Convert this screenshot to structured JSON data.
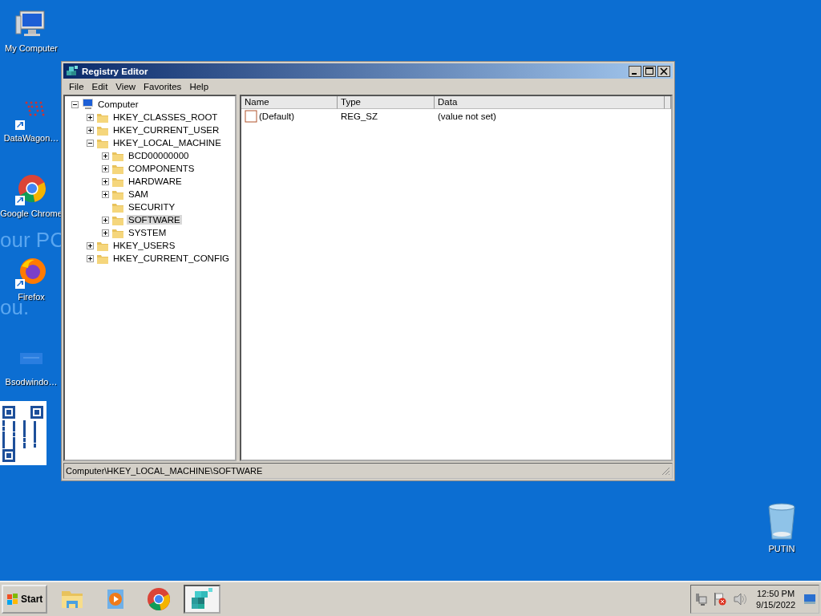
{
  "desktop": {
    "wallpaper_text": [
      "our PC",
      "ou."
    ],
    "icons": [
      {
        "label": "My Computer",
        "kind": "computer"
      },
      {
        "label": "DataWagon…",
        "kind": "datawagon"
      },
      {
        "label": "Google Chrome",
        "kind": "chrome"
      },
      {
        "label": "Firefox",
        "kind": "firefox"
      },
      {
        "label": "Bsodwindo…",
        "kind": "blank"
      },
      {
        "kind": "qr"
      }
    ],
    "recycle_bin": {
      "label": "PUTIN"
    }
  },
  "window": {
    "title": "Registry Editor",
    "menu": [
      "File",
      "Edit",
      "View",
      "Favorites",
      "Help"
    ],
    "tree": {
      "label": "Computer",
      "expanded": true,
      "selected": false,
      "children": [
        {
          "label": "HKEY_CLASSES_ROOT",
          "expanded": false,
          "selected": false,
          "has_children": true
        },
        {
          "label": "HKEY_CURRENT_USER",
          "expanded": false,
          "selected": false,
          "has_children": true
        },
        {
          "label": "HKEY_LOCAL_MACHINE",
          "expanded": true,
          "selected": false,
          "has_children": true,
          "children": [
            {
              "label": "BCD00000000",
              "expanded": false,
              "selected": false,
              "has_children": true
            },
            {
              "label": "COMPONENTS",
              "expanded": false,
              "selected": false,
              "has_children": true
            },
            {
              "label": "HARDWARE",
              "expanded": false,
              "selected": false,
              "has_children": true
            },
            {
              "label": "SAM",
              "expanded": false,
              "selected": false,
              "has_children": true
            },
            {
              "label": "SECURITY",
              "selected": false,
              "has_children": false
            },
            {
              "label": "SOFTWARE",
              "expanded": false,
              "selected": true,
              "has_children": true
            },
            {
              "label": "SYSTEM",
              "expanded": false,
              "selected": false,
              "has_children": true
            }
          ]
        },
        {
          "label": "HKEY_USERS",
          "expanded": false,
          "selected": false,
          "has_children": true
        },
        {
          "label": "HKEY_CURRENT_CONFIG",
          "expanded": false,
          "selected": false,
          "has_children": true
        }
      ]
    },
    "values": {
      "columns": [
        "Name",
        "Type",
        "Data"
      ],
      "rows": [
        {
          "name": "(Default)",
          "type": "REG_SZ",
          "data": "(value not set)"
        }
      ]
    },
    "status_bar": "Computer\\HKEY_LOCAL_MACHINE\\SOFTWARE"
  },
  "taskbar": {
    "start": "Start",
    "items": [
      {
        "kind": "explorer",
        "selected": false
      },
      {
        "kind": "media",
        "selected": false
      },
      {
        "kind": "chrome",
        "selected": false
      },
      {
        "kind": "regedit",
        "selected": true
      }
    ],
    "tray": {
      "time": "12:50 PM",
      "date": "9/15/2022"
    }
  }
}
